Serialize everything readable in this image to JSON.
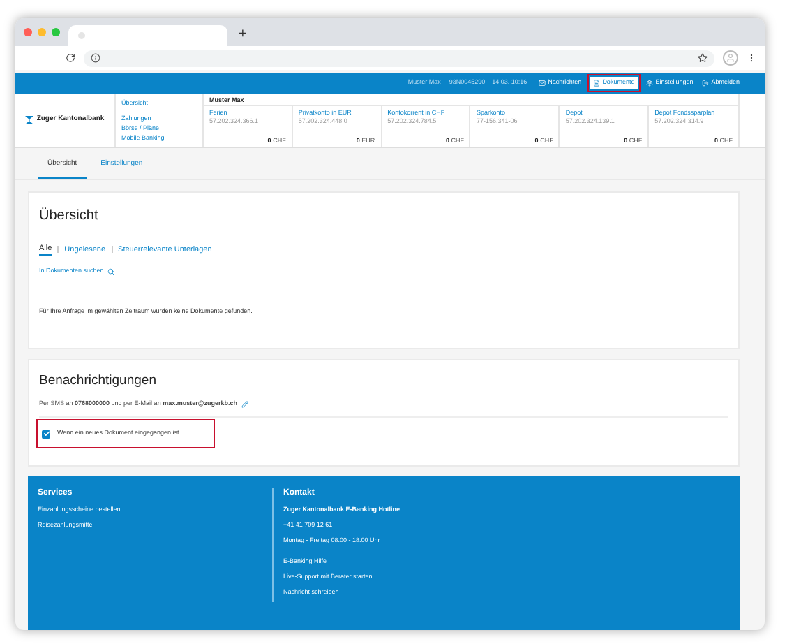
{
  "browser": {
    "new_tab": "+"
  },
  "topbar": {
    "user": "Muster Max",
    "session": "93N0045290 – 14.03. 10:16",
    "items": [
      {
        "label": "Nachrichten",
        "kind": "mail",
        "selected": false
      },
      {
        "label": "Dokumente",
        "kind": "doc",
        "selected": true
      },
      {
        "label": "Einstellungen",
        "kind": "gear",
        "selected": false
      },
      {
        "label": "Abmelden",
        "kind": "logout",
        "selected": false
      }
    ]
  },
  "brand": "Zuger Kantonalbank",
  "nav_links": [
    "Übersicht",
    "Zahlungen",
    "Börse / Pläne",
    "Mobile Banking"
  ],
  "account_holder": "Muster Max",
  "accounts": [
    {
      "name": "Ferien",
      "number": "57.202.324.366.1",
      "amount": "0",
      "currency": "CHF"
    },
    {
      "name": "Privatkonto in EUR",
      "number": "57.202.324.448.0",
      "amount": "0",
      "currency": "EUR"
    },
    {
      "name": "Kontokorrent in CHF",
      "number": "57.202.324.784.5",
      "amount": "0",
      "currency": "CHF"
    },
    {
      "name": "Sparkonto",
      "number": "77-156.341-06",
      "amount": "0",
      "currency": "CHF"
    },
    {
      "name": "Depot",
      "number": "57.202.324.139.1",
      "amount": "0",
      "currency": "CHF"
    },
    {
      "name": "Depot Fondssparplan",
      "number": "57.202.324.314.9",
      "amount": "0",
      "currency": "CHF"
    }
  ],
  "tabs": [
    {
      "label": "Übersicht",
      "selected": true
    },
    {
      "label": "Einstellungen",
      "selected": false
    }
  ],
  "overview": {
    "title": "Übersicht",
    "filters": [
      {
        "label": "Alle",
        "selected": true
      },
      {
        "label": "Ungelesene",
        "selected": false
      },
      {
        "label": "Steuerrelevante Unterlagen",
        "selected": false
      }
    ],
    "search_link": "In Dokumenten suchen",
    "empty_message": "Für Ihre Anfrage im gewählten Zeitraum wurden keine Dokumente gefunden."
  },
  "notifications": {
    "title": "Benachrichtigungen",
    "info": "Per SMS an **0768000000** und per E-Mail an **max.muster@zugerkb.ch**",
    "option": {
      "label": "Wenn ein neues Dokument eingegangen ist.",
      "checked": true,
      "highlighted": true
    }
  },
  "footer": {
    "services": {
      "title": "Services",
      "links": [
        "Einzahlungsscheine bestellen",
        "Reisezahlungsmittel"
      ]
    },
    "contact": {
      "title": "Kontakt",
      "hotline": "Zuger Kantonalbank E-Banking Hotline",
      "phone": "+41 41 709 12 61",
      "hours": "Montag - Freitag 08.00 - 18.00 Uhr",
      "help_title": "E-Banking Hilfe",
      "links": [
        "Live-Support mit Berater starten",
        "Nachricht schreiben"
      ]
    }
  }
}
